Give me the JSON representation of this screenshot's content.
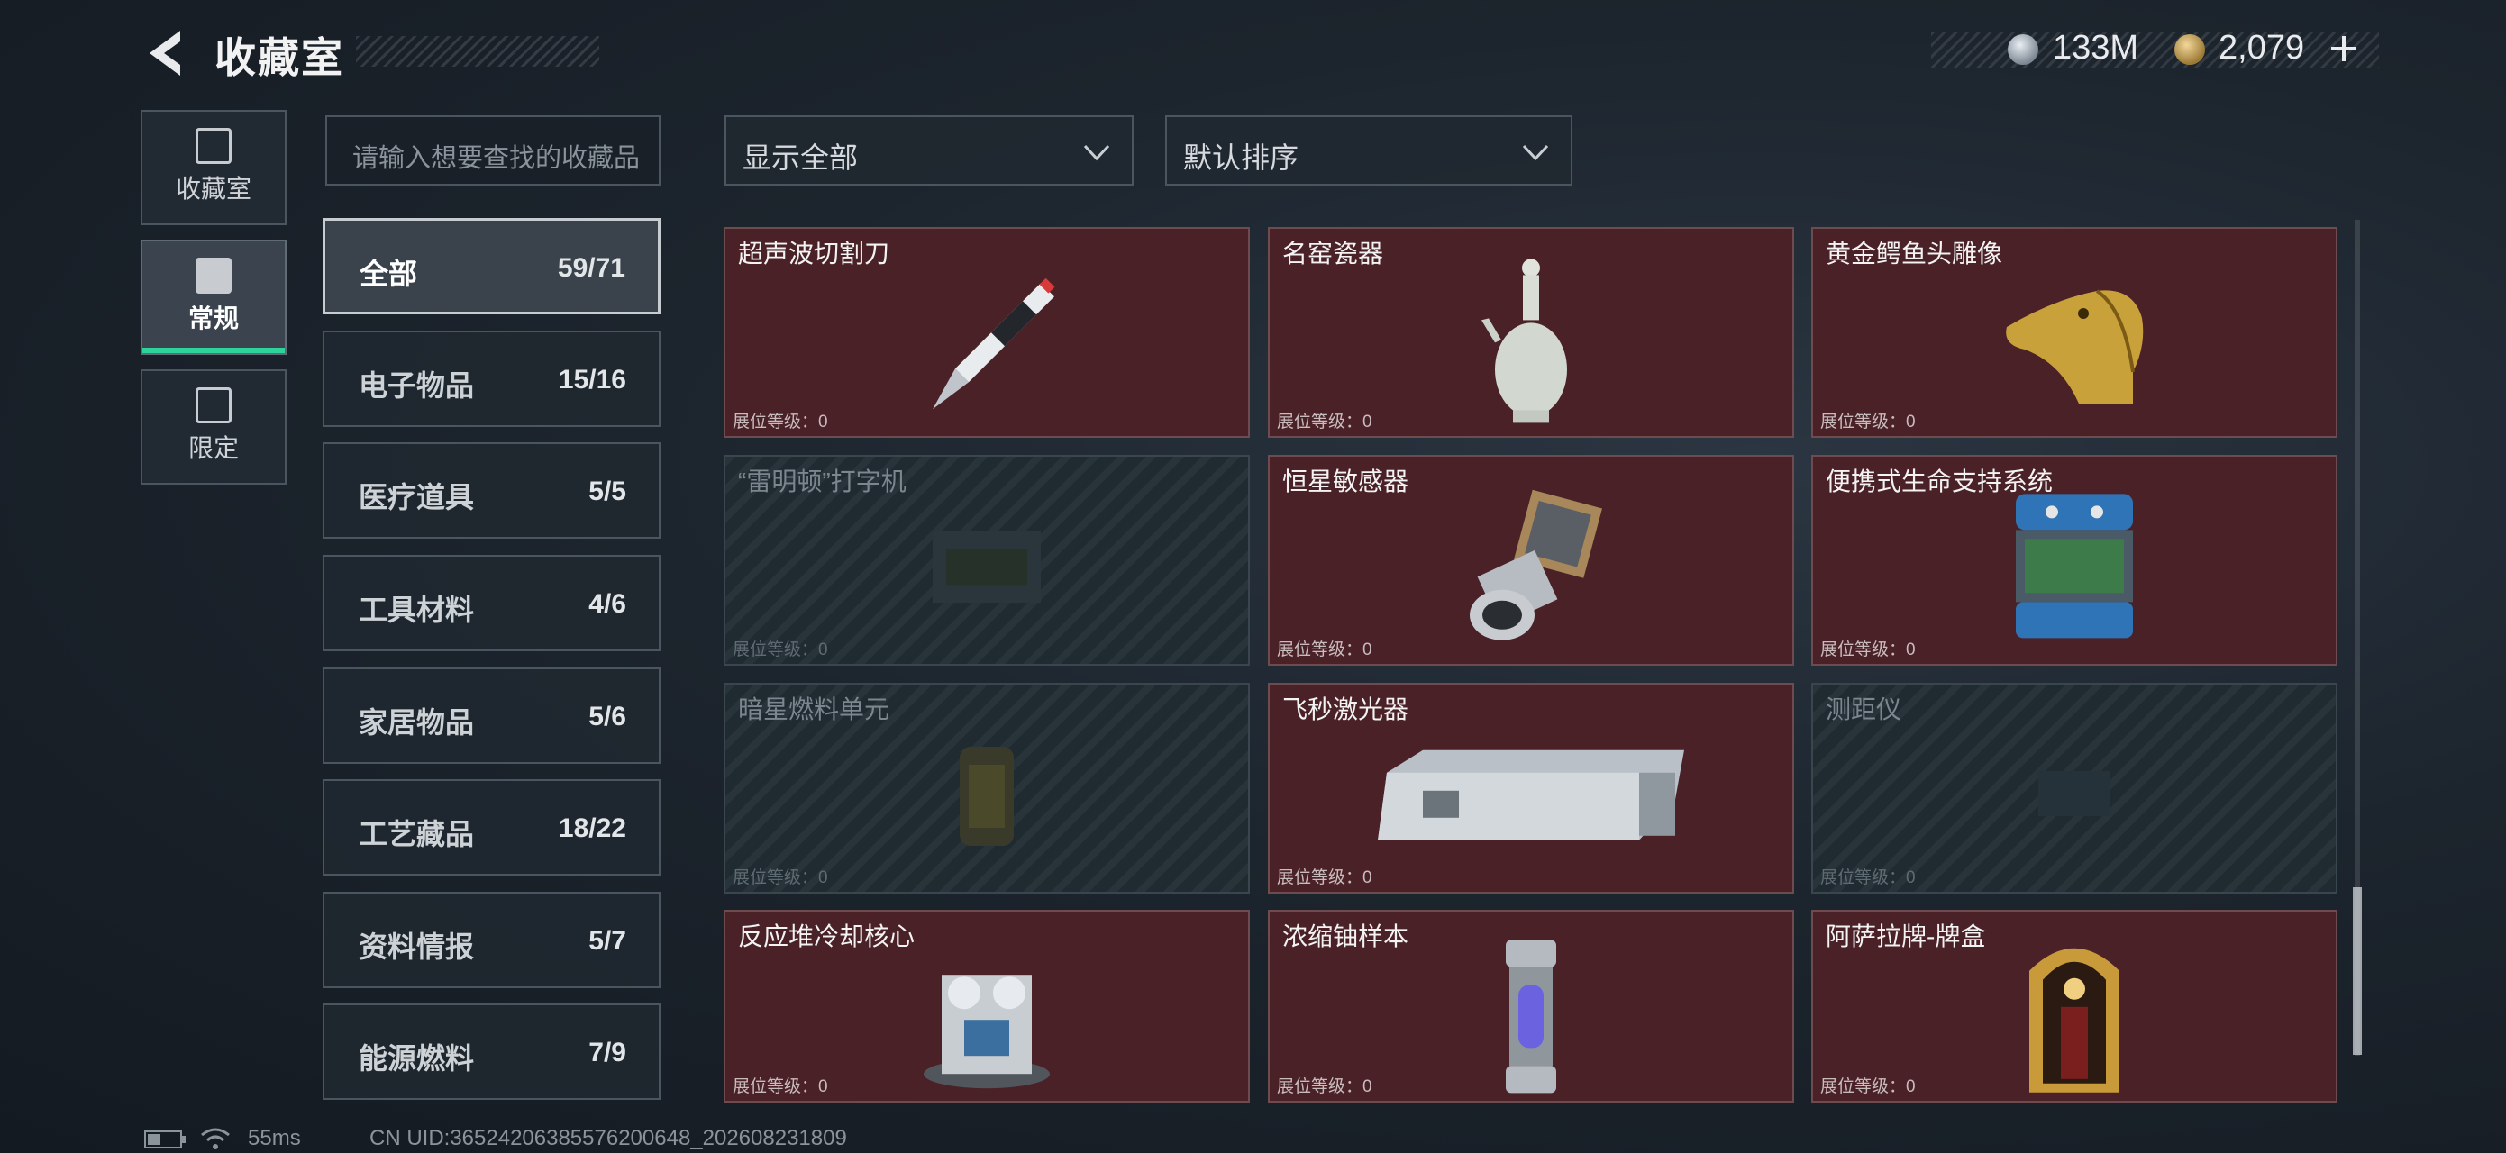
{
  "header": {
    "title": "收藏室"
  },
  "currency": [
    {
      "icon": "silver-coin-icon",
      "value": "133M"
    },
    {
      "icon": "gold-coin-icon",
      "value": "2,079"
    }
  ],
  "side_tabs": [
    {
      "label": "收藏室",
      "icon": "collection-room-icon"
    },
    {
      "label": "常规",
      "icon": "regular-icon",
      "active": true
    },
    {
      "label": "限定",
      "icon": "limited-icon"
    }
  ],
  "search": {
    "placeholder": "请输入想要查找的收藏品"
  },
  "categories": [
    {
      "name": "全部",
      "count": "59/71",
      "active": true
    },
    {
      "name": "电子物品",
      "count": "15/16"
    },
    {
      "name": "医疗道具",
      "count": "5/5"
    },
    {
      "name": "工具材料",
      "count": "4/6"
    },
    {
      "name": "家居物品",
      "count": "5/6"
    },
    {
      "name": "工艺藏品",
      "count": "18/22"
    },
    {
      "name": "资料情报",
      "count": "5/7"
    },
    {
      "name": "能源燃料",
      "count": "7/9"
    }
  ],
  "filters": {
    "display": "显示全部",
    "sort": "默认排序"
  },
  "level_label": "展位等级：0",
  "items": [
    {
      "name": "超声波切割刀",
      "locked": false,
      "icon": "ultrasonic-knife-icon"
    },
    {
      "name": "名窑瓷器",
      "locked": false,
      "icon": "porcelain-vase-icon"
    },
    {
      "name": "黄金鳄鱼头雕像",
      "locked": false,
      "icon": "golden-crocodile-head-icon"
    },
    {
      "name": "“雷明顿”打字机",
      "locked": true,
      "icon": "typewriter-icon"
    },
    {
      "name": "恒星敏感器",
      "locked": false,
      "icon": "star-sensor-icon"
    },
    {
      "name": "便携式生命支持系统",
      "locked": false,
      "icon": "life-support-icon"
    },
    {
      "name": "暗星燃料单元",
      "locked": true,
      "icon": "fuel-cell-icon"
    },
    {
      "name": "飞秒激光器",
      "locked": false,
      "icon": "femtosecond-laser-icon"
    },
    {
      "name": "测距仪",
      "locked": true,
      "icon": "rangefinder-icon"
    },
    {
      "name": "反应堆冷却核心",
      "locked": false,
      "icon": "reactor-core-icon"
    },
    {
      "name": "浓缩铀样本",
      "locked": false,
      "icon": "uranium-sample-icon"
    },
    {
      "name": "阿萨拉牌-牌盒",
      "locked": false,
      "icon": "card-box-icon"
    }
  ],
  "footer": {
    "ping": "55ms",
    "uid": "CN UID:36524206385576200648_202608231809"
  }
}
